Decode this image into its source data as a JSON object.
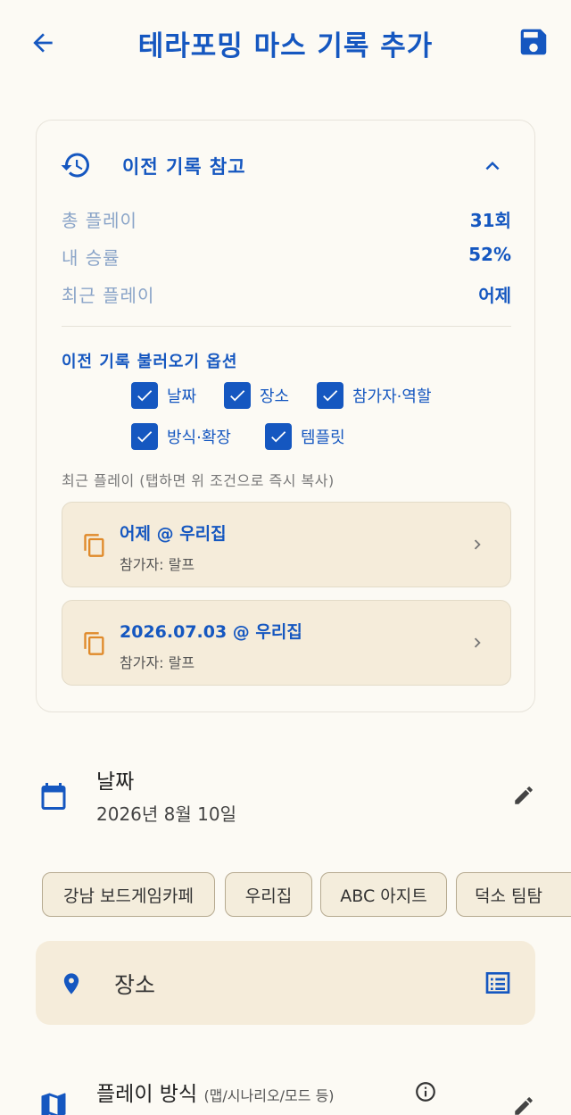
{
  "header": {
    "title": "테라포밍 마스 기록 추가"
  },
  "history_card": {
    "title": "이전 기록 참고",
    "stats": [
      {
        "label": "총 플레이",
        "value": "31회"
      },
      {
        "label": "내 승률",
        "value": "52%"
      },
      {
        "label": "최근 플레이",
        "value": "어제"
      }
    ],
    "options_title": "이전 기록 불러오기 옵션",
    "options": [
      {
        "label": "날짜",
        "checked": true
      },
      {
        "label": "장소",
        "checked": true
      },
      {
        "label": "참가자·역할",
        "checked": true
      },
      {
        "label": "방식·확장",
        "checked": true
      },
      {
        "label": "템플릿",
        "checked": true
      }
    ],
    "recent_caption": "최근 플레이 (탭하면 위 조건으로 즉시 복사)",
    "recent": [
      {
        "title": "어제 @ 우리집",
        "participants": "참가자: 랄프"
      },
      {
        "title": "2026.07.03 @ 우리집",
        "participants": "참가자: 랄프"
      }
    ]
  },
  "date_field": {
    "label": "날짜",
    "value": "2026년 8월 10일"
  },
  "place_chips": [
    "강남 보드게임카페",
    "우리집",
    "ABC 아지트",
    "덕소 팀탐"
  ],
  "place_field": {
    "placeholder": "장소"
  },
  "mode_field": {
    "label": "플레이 방식",
    "hint": "(맵/시나리오/모드 등)"
  },
  "colors": {
    "accent": "#1557c0",
    "background": "#fcfaf4",
    "card_fill": "#f5ecda",
    "copy_icon": "#e08a2a"
  }
}
